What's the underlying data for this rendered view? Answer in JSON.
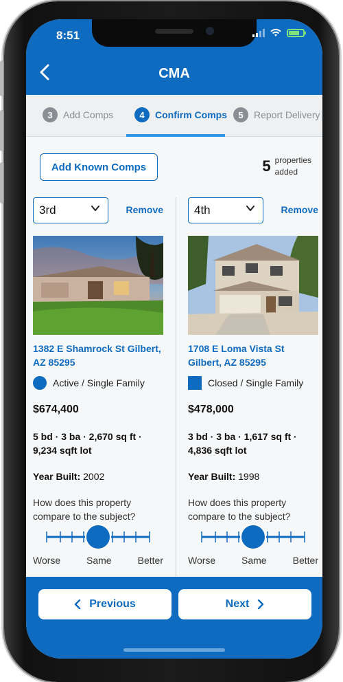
{
  "status_bar": {
    "time": "8:51"
  },
  "nav": {
    "title": "CMA",
    "back_icon": "chevron-left-icon"
  },
  "steps": [
    {
      "num": "3",
      "label": "Add Comps",
      "state": "inactive"
    },
    {
      "num": "4",
      "label": "Confirm Comps",
      "state": "active"
    },
    {
      "num": "5",
      "label": "Report Delivery",
      "state": "inactive"
    }
  ],
  "toolbar": {
    "add_known_label": "Add Known Comps",
    "count": "5",
    "count_line1": "properties",
    "count_line2": "added"
  },
  "comps": [
    {
      "rank": "3rd",
      "remove_label": "Remove",
      "address": "1382 E Shamrock St Gilbert, AZ 85295",
      "status": "Active / Single Family",
      "status_marker": "circle",
      "price": "$674,400",
      "specs": "5 bd · 3 ba · 2,670 sq ft · 9,234 sqft lot",
      "year_label": "Year Built:",
      "year": "2002",
      "question": "How does this property compare to the subject?",
      "slider_left": "Worse",
      "slider_mid": "Same",
      "slider_right": "Better"
    },
    {
      "rank": "4th",
      "remove_label": "Remove",
      "address": "1708 E Loma Vista St Gilbert, AZ 85295",
      "status": "Closed / Single Family",
      "status_marker": "square",
      "price": "$478,000",
      "specs": "3 bd · 3 ba · 1,617 sq ft · 4,836 sqft lot",
      "year_label": "Year Built:",
      "year": "1998",
      "question": "How does this property compare to the subject?",
      "slider_left": "Worse",
      "slider_mid": "Same",
      "slider_right": "Better"
    }
  ],
  "footer": {
    "prev_label": "Previous",
    "next_label": "Next"
  },
  "colors": {
    "primary": "#0e6bbf",
    "accent_underline": "#2f95e8"
  }
}
